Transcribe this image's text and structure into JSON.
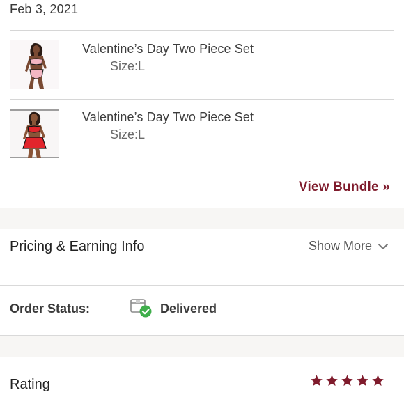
{
  "order": {
    "date": "Feb 3, 2021"
  },
  "items": [
    {
      "title": "Valentine’s Day Two Piece Set",
      "size": "Size:L",
      "variant": "pink"
    },
    {
      "title": "Valentine’s Day Two Piece Set",
      "size": "Size:L",
      "variant": "red"
    }
  ],
  "bundle": {
    "view_label": "View Bundle »"
  },
  "pricing": {
    "title": "Pricing & Earning Info",
    "show_more_label": "Show More"
  },
  "status": {
    "label": "Order Status:",
    "value": "Delivered",
    "icon": "box-check-icon"
  },
  "rating": {
    "title": "Rating",
    "stars": 5,
    "max": 5
  },
  "colors": {
    "accent": "#7f1b2c",
    "delivered_green": "#3fae4b",
    "band_bg": "#f7f6f4"
  }
}
